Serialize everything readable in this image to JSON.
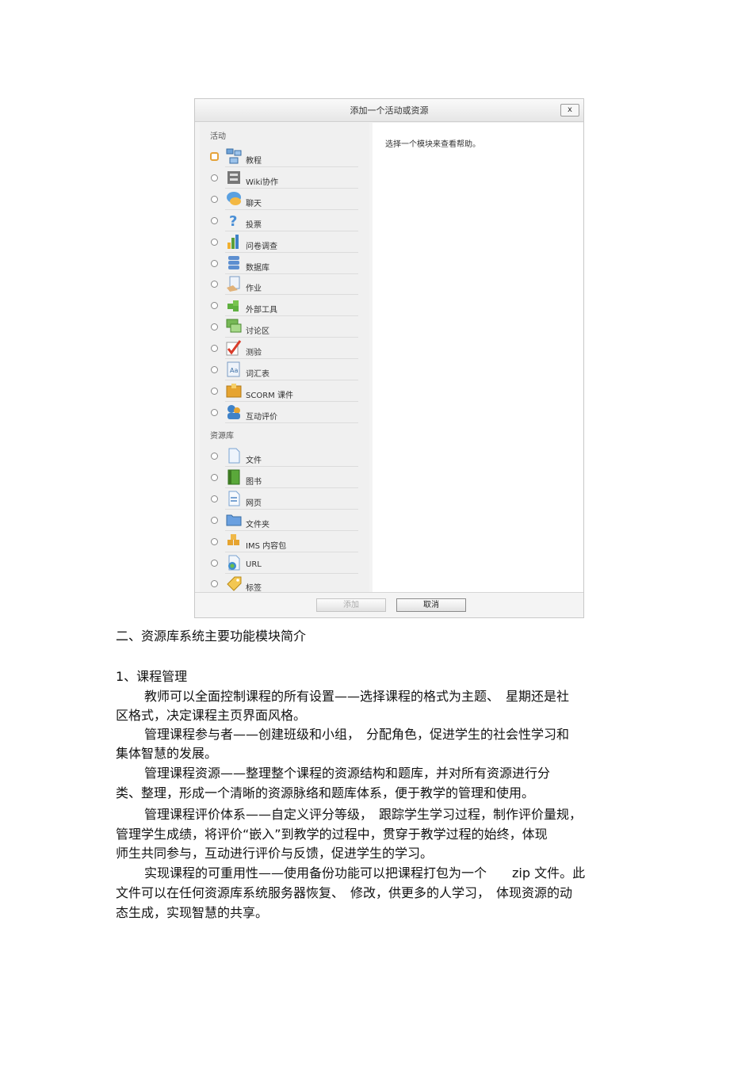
{
  "dialog": {
    "title": "添加一个活动或资源",
    "close_label": "x",
    "help_text": "选择一个模块来查看帮助。",
    "activities_heading": "活动",
    "activities": [
      {
        "label": "教程",
        "icon": "lesson-icon",
        "selected": true
      },
      {
        "label": "Wiki协作",
        "icon": "wiki-icon"
      },
      {
        "label": "聊天",
        "icon": "chat-icon"
      },
      {
        "label": "投票",
        "icon": "choice-icon"
      },
      {
        "label": "问卷调查",
        "icon": "survey-icon"
      },
      {
        "label": "数据库",
        "icon": "database-icon"
      },
      {
        "label": "作业",
        "icon": "assignment-icon"
      },
      {
        "label": "外部工具",
        "icon": "external-tool-icon"
      },
      {
        "label": "讨论区",
        "icon": "forum-icon"
      },
      {
        "label": "测验",
        "icon": "quiz-icon"
      },
      {
        "label": "词汇表",
        "icon": "glossary-icon"
      },
      {
        "label": "SCORM 课件",
        "icon": "scorm-icon"
      },
      {
        "label": "互动评价",
        "icon": "workshop-icon"
      }
    ],
    "resources_heading": "资源库",
    "resources": [
      {
        "label": "文件",
        "icon": "file-icon"
      },
      {
        "label": "图书",
        "icon": "book-icon"
      },
      {
        "label": "网页",
        "icon": "page-icon"
      },
      {
        "label": "文件夹",
        "icon": "folder-icon"
      },
      {
        "label": "IMS 内容包",
        "icon": "ims-package-icon"
      },
      {
        "label": "URL",
        "icon": "url-icon"
      },
      {
        "label": "标签",
        "icon": "label-icon"
      }
    ],
    "add_label": "添加",
    "cancel_label": "取消"
  },
  "document": {
    "section_heading": "二、资源库系统主要功能模块简介",
    "subheading": "1、课程管理",
    "lines": [
      "教师可以全面控制课程的所有设置——选择课程的格式为主题、　星期还是社",
      "区格式，决定课程主页界面风格。",
      "管理课程参与者——创建班级和小组，　分配角色，促进学生的社会性学习和",
      "集体智慧的发展。",
      "管理课程资源——整理整个课程的资源结构和题库，并对所有资源进行分",
      "类、整理，形成一个清晰的资源脉络和题库体系，便于教学的管理和使用。",
      "管理课程评价体系——自定义评分等级，　跟踪学生学习过程，制作评价量规，",
      "管理学生成绩，将评价“嵌入”到教学的过程中，贯穿于教学过程的始终，体现",
      "师生共同参与，互动进行评价与反馈，促进学生的学习。",
      "实现课程的可重用性——使用备份功能可以把课程打包为一个　　zip 文件。此",
      "文件可以在任何资源库系统服务器恢复、　修改，供更多的人学习，　体现资源的动",
      "态生成，实现智慧的共享。"
    ]
  }
}
